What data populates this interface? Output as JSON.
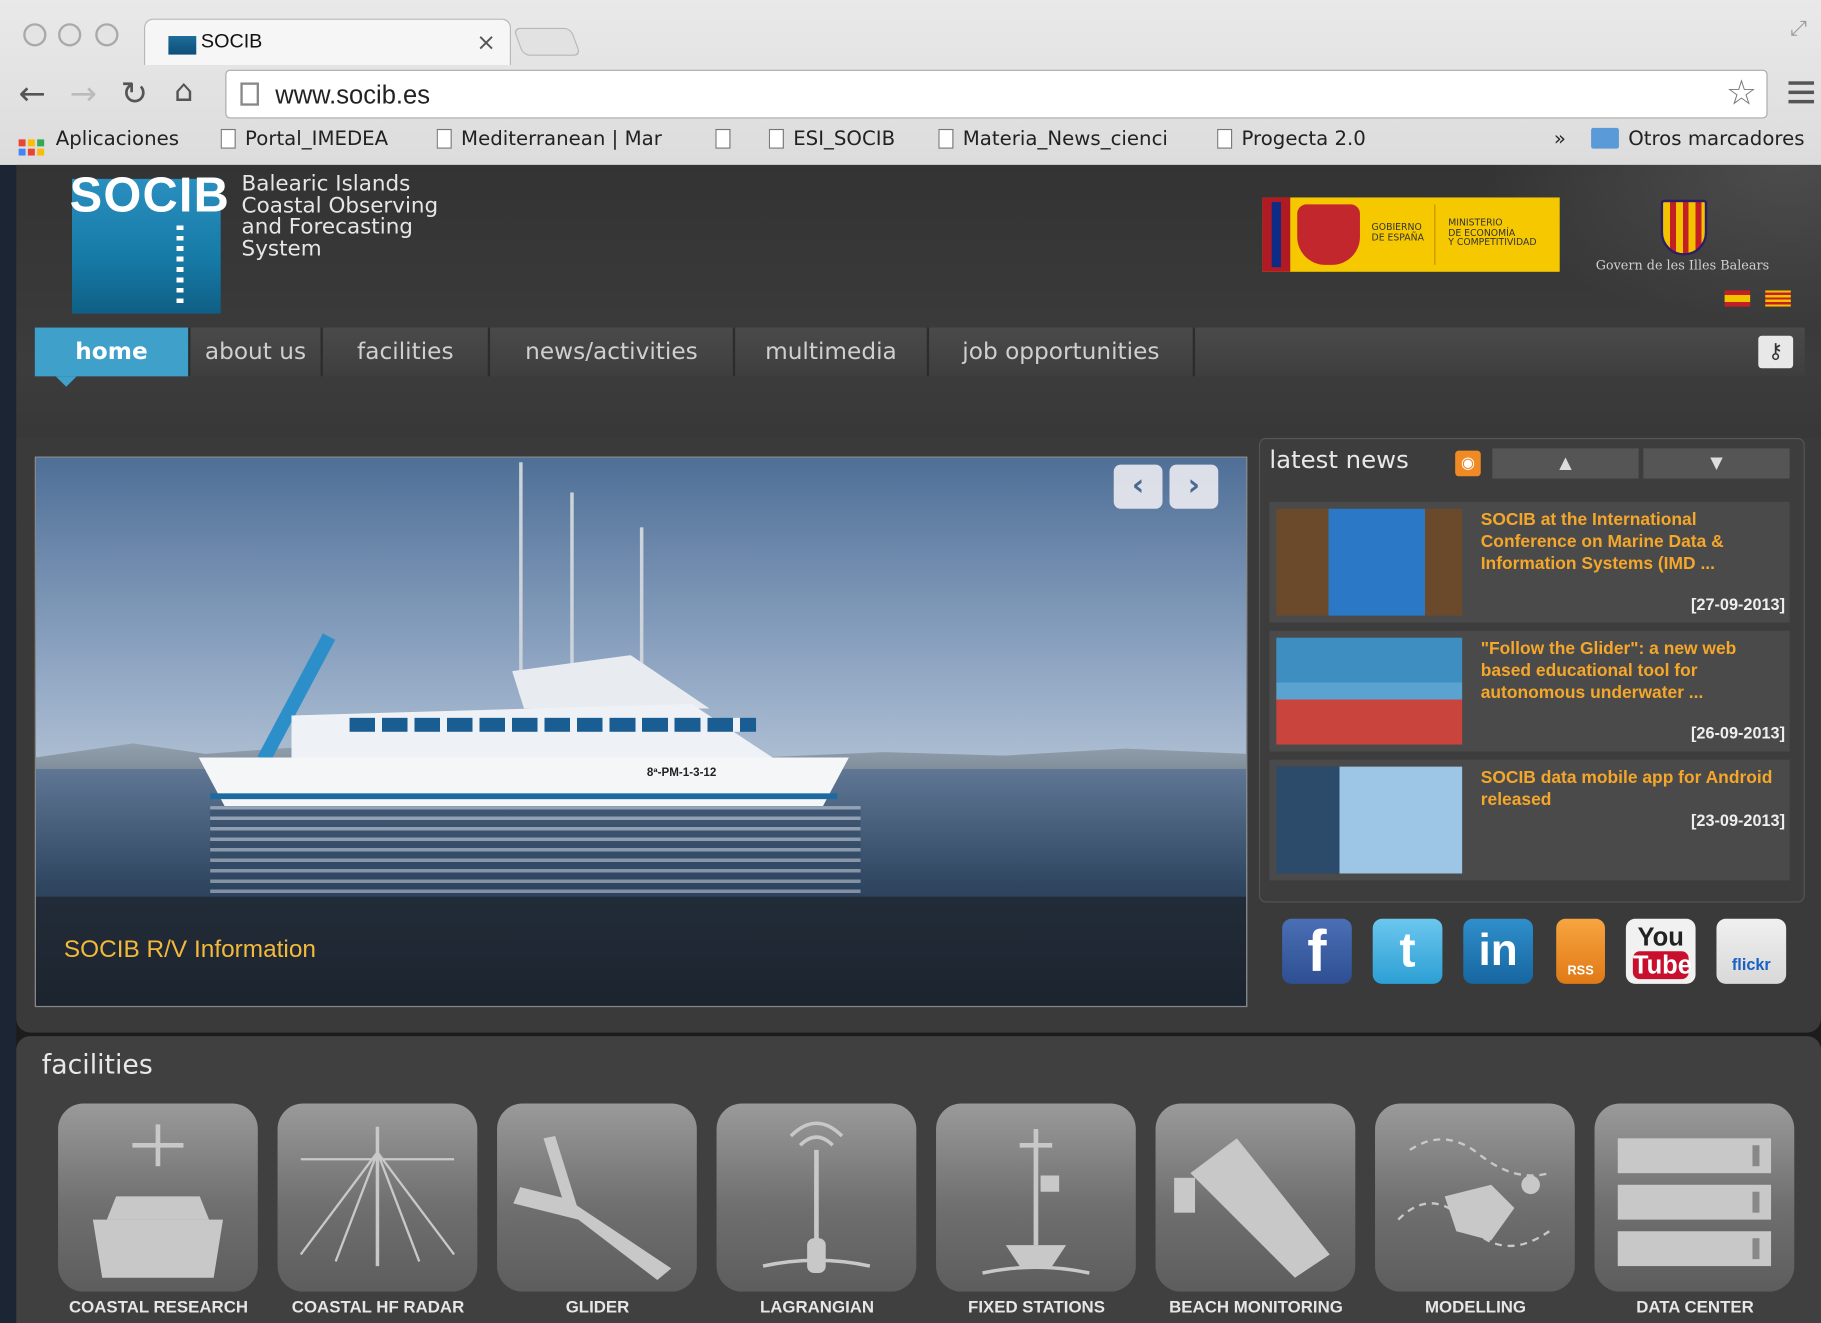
{
  "browser": {
    "tab_title": "SOCIB",
    "tab_close": "×",
    "url": "www.socib.es",
    "bookmarks": [
      {
        "label": "Aplicaciones",
        "icon": "apps-grid-icon"
      },
      {
        "label": "Portal_IMEDEA",
        "icon": "page-icon"
      },
      {
        "label": "Mediterranean | Mar",
        "icon": "page-icon"
      },
      {
        "label": "",
        "icon": "page-icon"
      },
      {
        "label": "ESI_SOCIB",
        "icon": "page-icon"
      },
      {
        "label": "Materia_News_cienci",
        "icon": "page-icon"
      },
      {
        "label": "Progecta 2.0",
        "icon": "page-icon"
      }
    ],
    "bookmarks_overflow": "»",
    "other_bookmarks": "Otros marcadores"
  },
  "header": {
    "logo_text": "SOCIB",
    "tagline": [
      "Balearic Islands",
      "Coastal Observing",
      "and Forecasting",
      "System"
    ],
    "gov_es_left": [
      "GOBIERNO",
      "DE ESPAÑA"
    ],
    "gov_es_right": [
      "MINISTERIO",
      "DE ECONOMÍA",
      "Y COMPETITIVIDAD"
    ],
    "gov_ib": "Govern de les Illes Balears"
  },
  "nav": {
    "items": [
      "home",
      "about us",
      "facilities",
      "news/activities",
      "multimedia",
      "job opportunities"
    ],
    "active": "home",
    "login_icon": "key-icon"
  },
  "slideshow": {
    "caption": "SOCIB R/V Information",
    "prev": "‹",
    "next": "›",
    "hull_id": "8ª-PM-1-3-12"
  },
  "news": {
    "title": "latest news",
    "up": "▲",
    "down": "▼",
    "items": [
      {
        "title": "SOCIB at the International Conference on Marine Data & Information Systems (IMD ...",
        "date": "[27-09-2013]"
      },
      {
        "title": "\"Follow the Glider\": a new web based educational tool for autonomous underwater ...",
        "date": "[26-09-2013]"
      },
      {
        "title": "SOCIB data mobile app for Android released",
        "date": "[23-09-2013]"
      }
    ]
  },
  "social": [
    {
      "name": "facebook",
      "label": "f"
    },
    {
      "name": "twitter",
      "label": "t"
    },
    {
      "name": "linkedin",
      "label": "in"
    },
    {
      "name": "rss",
      "label": "RSS"
    },
    {
      "name": "youtube",
      "label_top": "You",
      "label_bottom": "Tube"
    },
    {
      "name": "flickr",
      "label": "flickr"
    }
  ],
  "facilities": {
    "title": "facilities",
    "items": [
      "COASTAL RESEARCH",
      "COASTAL HF RADAR",
      "GLIDER",
      "LAGRANGIAN",
      "FIXED STATIONS",
      "BEACH MONITORING",
      "MODELLING",
      "DATA CENTER"
    ]
  },
  "colors": {
    "accent": "#3fa0c9",
    "news_title": "#f4a72b",
    "caption": "#f3b93a"
  }
}
